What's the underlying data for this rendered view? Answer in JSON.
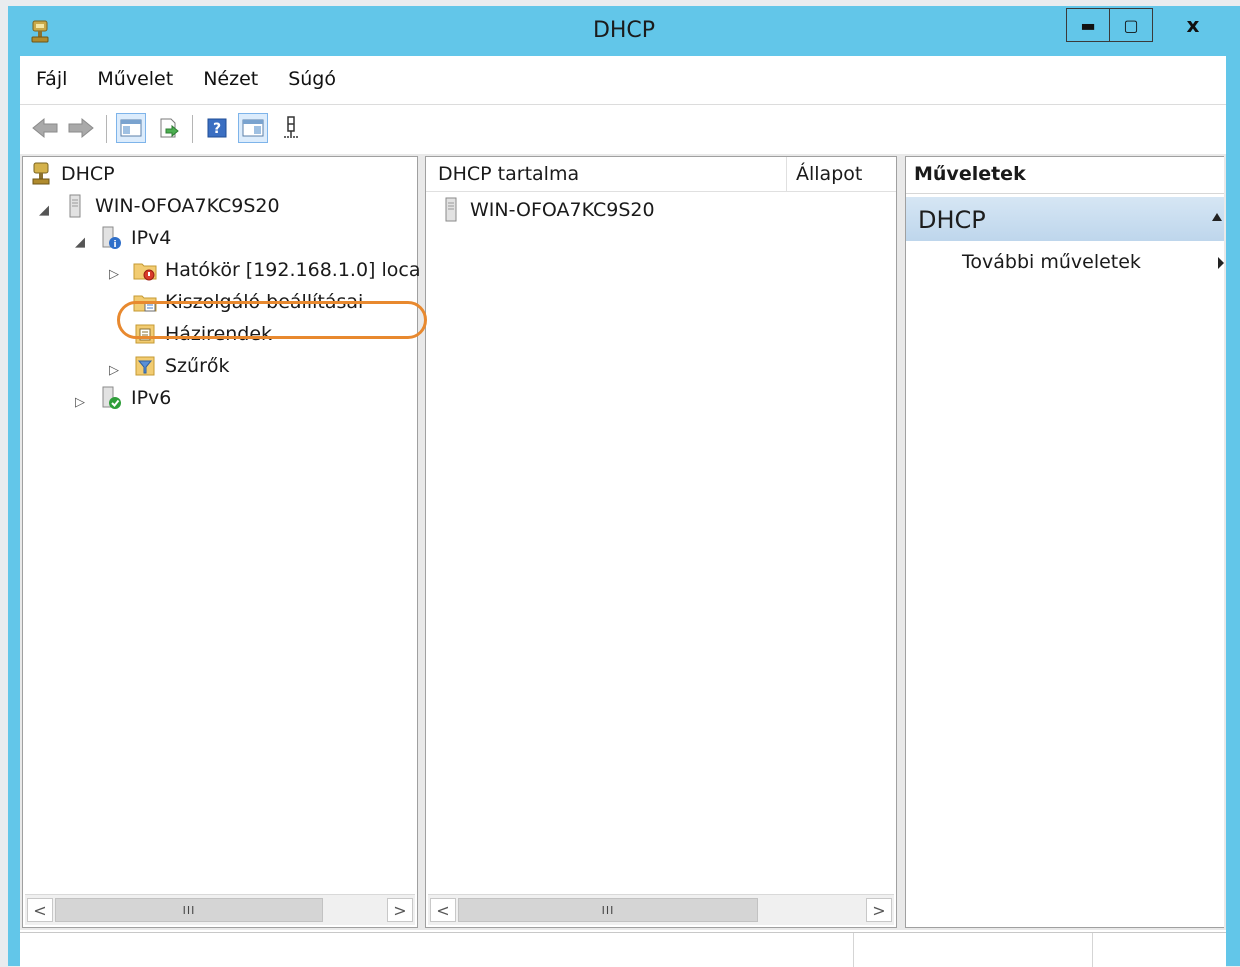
{
  "window": {
    "title": "DHCP",
    "minimize": "▬",
    "maximize": "▢",
    "close": "x"
  },
  "menu": {
    "items": [
      "Fájl",
      "Művelet",
      "Nézet",
      "Súgó"
    ]
  },
  "toolbar": {
    "buttons": [
      "back-icon",
      "forward-icon",
      "show-hide-console-tree-icon",
      "export-list-icon",
      "help-icon",
      "show-hide-action-pane-icon",
      "server-status-icon"
    ]
  },
  "tree": {
    "root": "DHCP",
    "server": "WIN-OFOA7KC9S20",
    "ipv4": "IPv4",
    "scope": "Hatókör [192.168.1.0] loca",
    "server_options": "Kiszolgáló beállításai",
    "policies": "Házirendek",
    "filters": "Szűrők",
    "ipv6": "IPv6"
  },
  "list": {
    "columns": {
      "name": "DHCP tartalma",
      "status": "Állapot"
    },
    "rows": [
      {
        "name": "WIN-OFOA7KC9S20",
        "status": ""
      }
    ]
  },
  "scrollbar": {
    "left_arrow": "<",
    "right_arrow": ">",
    "thumb_grip": "III"
  },
  "actions": {
    "title": "Műveletek",
    "section": "DHCP",
    "more": "További műveletek"
  },
  "colors": {
    "title_bar": "#62c6e9",
    "highlight": "#e8892f",
    "action_section": "#c8dcef"
  }
}
